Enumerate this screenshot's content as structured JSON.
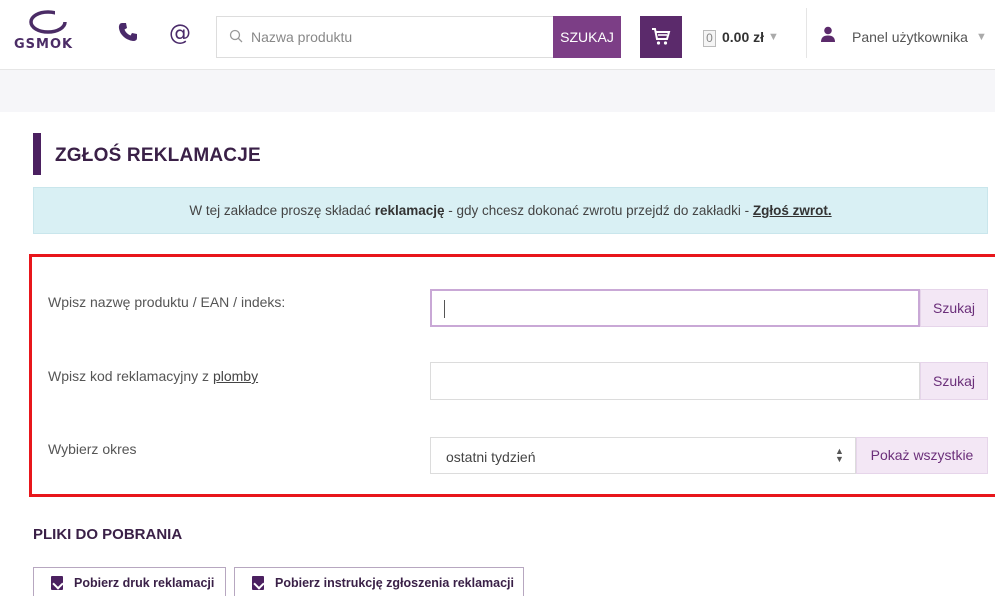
{
  "header": {
    "logo_text": "GSMOK",
    "search": {
      "placeholder": "Nazwa produktu",
      "button_label": "SZUKAJ"
    },
    "cart": {
      "count": "0",
      "total": "0.00 zł"
    },
    "user_panel_label": "Panel użytkownika"
  },
  "page": {
    "title": "ZGŁOŚ REKLAMACJE",
    "info": {
      "before": "W tej zakładce proszę składać ",
      "bold": "reklamację",
      "middle": " - gdy chcesz dokonać zwrotu przejdź do zakładki - ",
      "link": "Zgłoś zwrot."
    }
  },
  "form": {
    "product": {
      "label": "Wpisz nazwę produktu / EAN / indeks:",
      "value": "",
      "button": "Szukaj"
    },
    "code": {
      "label_prefix": "Wpisz kod reklamacyjny z ",
      "label_link": "plomby",
      "value": "",
      "button": "Szukaj"
    },
    "period": {
      "label": "Wybierz okres",
      "selected": "ostatni tydzień",
      "button": "Pokaż wszystkie"
    }
  },
  "downloads": {
    "title": "PLIKI DO POBRANIA",
    "buttons": [
      "Pobierz druk reklamacji",
      "Pobierz instrukcję zgłoszenia reklamacji"
    ]
  },
  "colors": {
    "brand": "#5b2a6b",
    "accent": "#7c3e86",
    "highlight": "#e8161b",
    "info_bg": "#d9f0f4"
  }
}
